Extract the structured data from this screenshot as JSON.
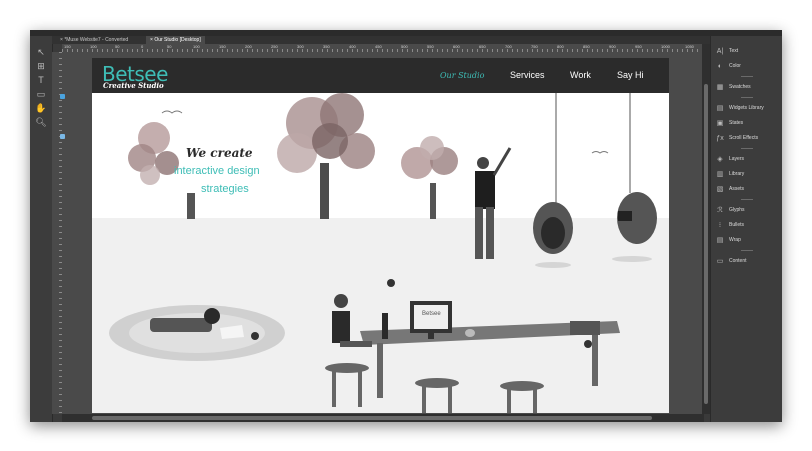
{
  "tabs": [
    {
      "label": "*Muse Website7 - Converted"
    },
    {
      "label": "Our Studio [Desktop]"
    }
  ],
  "ruler": {
    "labels": [
      "150",
      "100",
      "50",
      "0",
      "50",
      "100",
      "150",
      "200",
      "250",
      "300",
      "350",
      "400",
      "450",
      "500",
      "550",
      "600",
      "650",
      "700",
      "750",
      "800",
      "850",
      "900",
      "950",
      "1000",
      "1050"
    ]
  },
  "site": {
    "logo": "Betsee",
    "tagline": "Creative Studio",
    "nav": [
      "Our Studio",
      "Services",
      "Work",
      "Say Hi"
    ],
    "hero_line1": "We create",
    "hero_line2": "interactive design",
    "hero_line3": "strategies",
    "monitor_text": "Betsee"
  },
  "panels": [
    {
      "label": "Text",
      "icon": "text-icon"
    },
    {
      "label": "Color",
      "icon": "color-icon"
    },
    {
      "label": "Swatches",
      "icon": "swatches-icon"
    },
    {
      "label": "Widgets Library",
      "icon": "widgets-library-icon"
    },
    {
      "label": "States",
      "icon": "states-icon"
    },
    {
      "label": "Scroll Effects",
      "icon": "scroll-effects-icon"
    },
    {
      "label": "Layers",
      "icon": "layers-icon"
    },
    {
      "label": "Library",
      "icon": "library-icon"
    },
    {
      "label": "Assets",
      "icon": "assets-icon"
    },
    {
      "label": "Glyphs",
      "icon": "glyphs-icon"
    },
    {
      "label": "Bullets",
      "icon": "bullets-icon"
    },
    {
      "label": "Wrap",
      "icon": "wrap-icon"
    },
    {
      "label": "Content",
      "icon": "content-icon"
    }
  ],
  "colors": {
    "accent": "#3ebdb6",
    "header": "#2b2b2b",
    "chrome": "#3a3a3a"
  }
}
